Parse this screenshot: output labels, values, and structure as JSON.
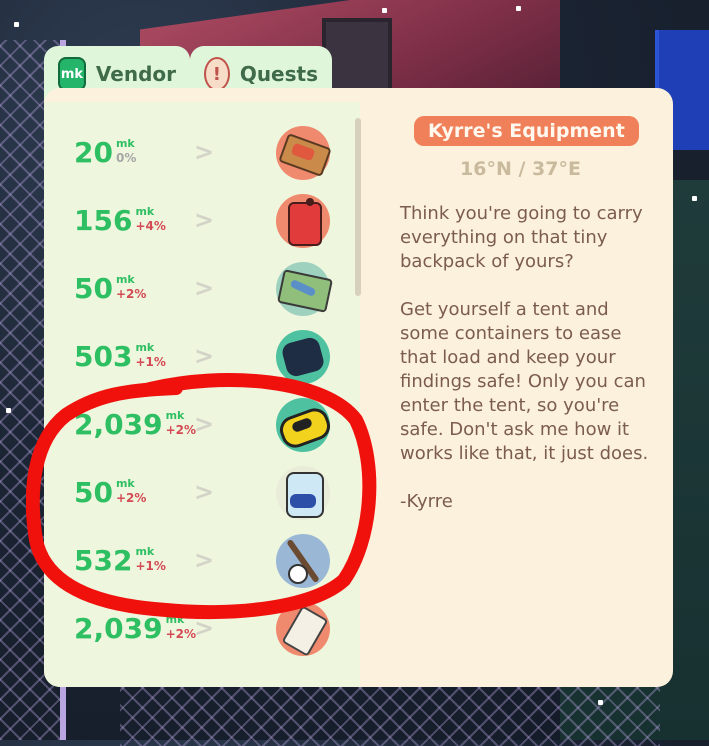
{
  "tabs": [
    {
      "label": "Vendor",
      "icon": "mk"
    },
    {
      "label": "Quests",
      "icon": "!"
    }
  ],
  "items": [
    {
      "price": "20",
      "unit": "mk",
      "change": "0%",
      "trend": "neutral",
      "icon": "matchbox-icon"
    },
    {
      "price": "156",
      "unit": "mk",
      "change": "+4%",
      "trend": "up",
      "icon": "fuel-can-icon"
    },
    {
      "price": "50",
      "unit": "mk",
      "change": "+2%",
      "trend": "up",
      "icon": "map-icon"
    },
    {
      "price": "503",
      "unit": "mk",
      "change": "+1%",
      "trend": "up",
      "icon": "sleeping-mat-icon"
    },
    {
      "price": "2,039",
      "unit": "mk",
      "change": "+2%",
      "trend": "up",
      "icon": "inflatable-raft-icon"
    },
    {
      "price": "50",
      "unit": "mk",
      "change": "+2%",
      "trend": "up",
      "icon": "water-bag-icon"
    },
    {
      "price": "532",
      "unit": "mk",
      "change": "+1%",
      "trend": "up",
      "icon": "fishing-rod-icon"
    },
    {
      "price": "2,039",
      "unit": "mk",
      "change": "+2%",
      "trend": "up",
      "icon": "tent-icon"
    }
  ],
  "vendor": {
    "title": "Kyrre's Equipment",
    "coords": "16°N / 37°E",
    "description": [
      "Think you're going to carry everything on that tiny backpack of yours?",
      "Get yourself a tent and some containers to ease that load and keep your findings safe! Only you can enter the tent, so you're safe. Don't ask me how it works like that, it just does.",
      "-Kyrre"
    ]
  },
  "colors": {
    "price_green": "#2fbf63",
    "change_red": "#d44b55",
    "title_orange": "#f0805a",
    "annotation_red": "#f0110d"
  }
}
